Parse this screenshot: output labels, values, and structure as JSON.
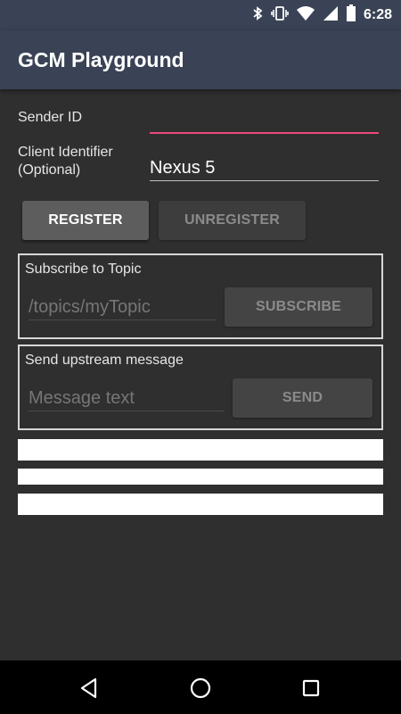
{
  "statusbar": {
    "time": "6:28",
    "icons": [
      "bluetooth-icon",
      "vibrate-icon",
      "wifi-icon",
      "signal-icon",
      "battery-icon"
    ]
  },
  "app": {
    "title": "GCM Playground"
  },
  "form": {
    "sender_id_label": "Sender ID",
    "sender_id_value": "",
    "client_identifier_label_line1": "Client Identifier",
    "client_identifier_label_line2": "(Optional)",
    "client_identifier_value": "Nexus 5"
  },
  "buttons": {
    "register": "REGISTER",
    "unregister": "UNREGISTER"
  },
  "topic": {
    "title": "Subscribe to Topic",
    "placeholder": "/topics/myTopic",
    "button": "SUBSCRIBE"
  },
  "upstream": {
    "title": "Send upstream message",
    "placeholder": "Message text",
    "button": "SEND"
  },
  "navbar": {
    "icons": [
      "back-icon",
      "home-icon",
      "recents-icon"
    ]
  }
}
